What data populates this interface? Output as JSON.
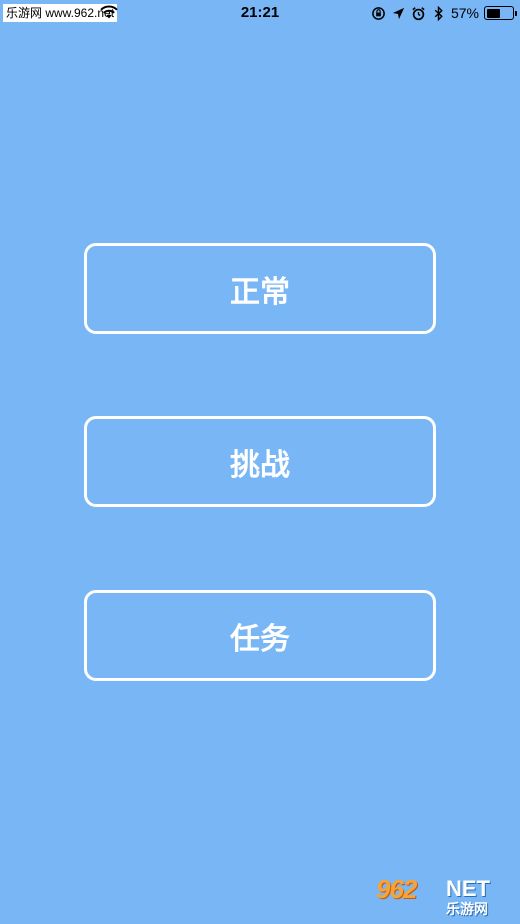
{
  "status_bar": {
    "carrier": "乐游网 www.962.net",
    "time": "21:21",
    "battery_percent": "57%",
    "battery_level": 0.57,
    "icons": [
      "wifi-icon",
      "orientation-lock-icon",
      "location-icon",
      "alarm-icon",
      "bluetooth-icon"
    ]
  },
  "menu": {
    "normal_label": "正常",
    "challenge_label": "挑战",
    "task_label": "任务"
  },
  "watermark": {
    "logo": "962",
    "net": "NET",
    "sub": "乐游网"
  },
  "colors": {
    "background": "#78b6f5",
    "button_border": "#ffffff",
    "button_text": "#ffffff"
  }
}
